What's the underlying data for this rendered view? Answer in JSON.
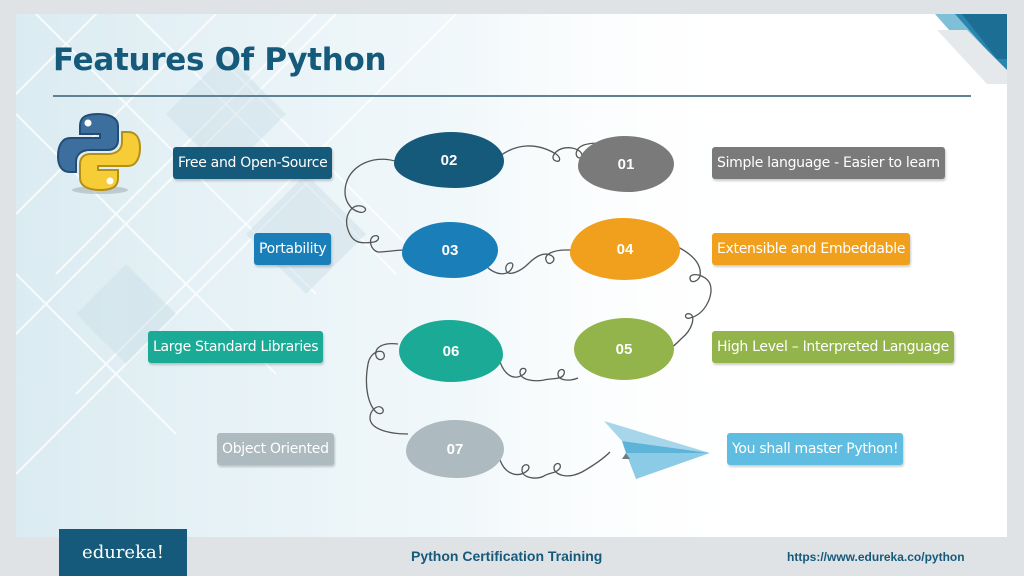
{
  "slide": {
    "title": "Features Of Python",
    "logo_icon": "python-logo-icon",
    "colors": {
      "title": "#155a7a",
      "step01": "#7a7a7a",
      "step02": "#155a7a",
      "step03": "#1a7fb8",
      "step04": "#f0a01c",
      "step05": "#93b44a",
      "step06": "#1aaa96",
      "step07": "#adbac0",
      "final": "#5ebde0"
    },
    "features": [
      {
        "number": "01",
        "label": "Simple language - Easier to learn"
      },
      {
        "number": "02",
        "label": "Free and Open-Source"
      },
      {
        "number": "03",
        "label": "Portability"
      },
      {
        "number": "04",
        "label": "Extensible and Embeddable"
      },
      {
        "number": "05",
        "label": "High Level – Interpreted Language"
      },
      {
        "number": "06",
        "label": "Large Standard Libraries"
      },
      {
        "number": "07",
        "label": "Object Oriented"
      }
    ],
    "final_message": "You shall master Python!",
    "final_icon": "paper-plane-icon"
  },
  "footer": {
    "brand": "edureka!",
    "course": "Python Certification Training",
    "url": "https://www.edureka.co/python"
  }
}
